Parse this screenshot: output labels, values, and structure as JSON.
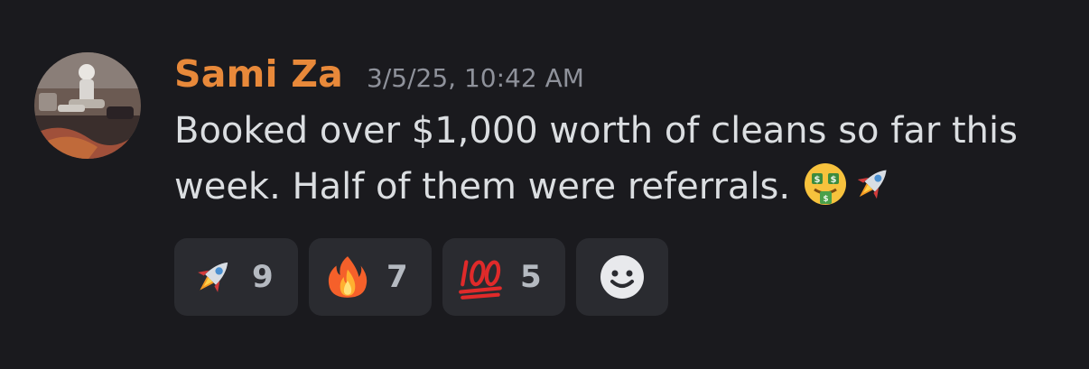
{
  "message": {
    "username": "Sami Za",
    "timestamp": "3/5/25, 10:42 AM",
    "text_line1": "Booked over $1,000 worth of cleans so far this",
    "text_line2": "week. Half of them were referrals.",
    "inline_emojis": [
      "money-mouth-face",
      "rocket"
    ]
  },
  "reactions": [
    {
      "emoji": "rocket",
      "count": "9"
    },
    {
      "emoji": "fire",
      "count": "7"
    },
    {
      "emoji": "hundred-points",
      "count": "5"
    }
  ],
  "colors": {
    "background": "#1a1a1e",
    "username": "#e8893a",
    "timestamp": "#8f929b",
    "text": "#dbdee1",
    "reaction_bg": "#2a2b30"
  }
}
